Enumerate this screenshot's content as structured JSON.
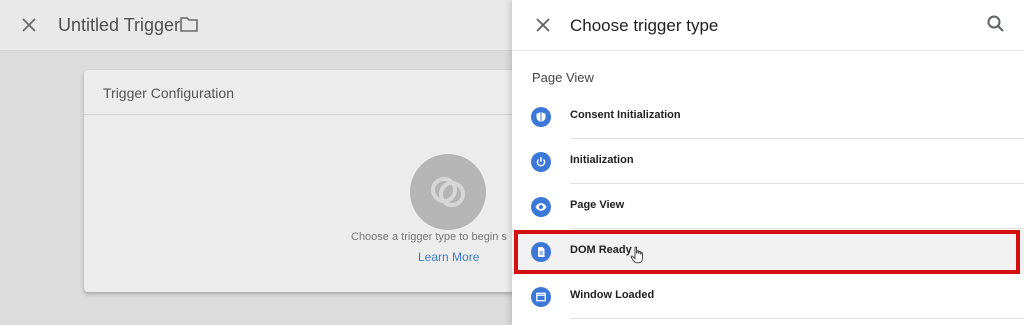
{
  "left": {
    "title": "Untitled Trigger",
    "card": {
      "title": "Trigger Configuration",
      "prompt": "Choose a trigger type to begin s",
      "link": "Learn More"
    }
  },
  "panel": {
    "title": "Choose trigger type",
    "section": "Page View",
    "items": [
      {
        "label": "Consent Initialization",
        "icon": "shield-icon"
      },
      {
        "label": "Initialization",
        "icon": "power-icon"
      },
      {
        "label": "Page View",
        "icon": "eye-icon"
      },
      {
        "label": "DOM Ready",
        "icon": "document-icon"
      },
      {
        "label": "Window Loaded",
        "icon": "window-icon"
      }
    ]
  },
  "colors": {
    "accent": "#3b78d8",
    "highlight": "#d30f0f",
    "link": "#3d7cc9"
  }
}
